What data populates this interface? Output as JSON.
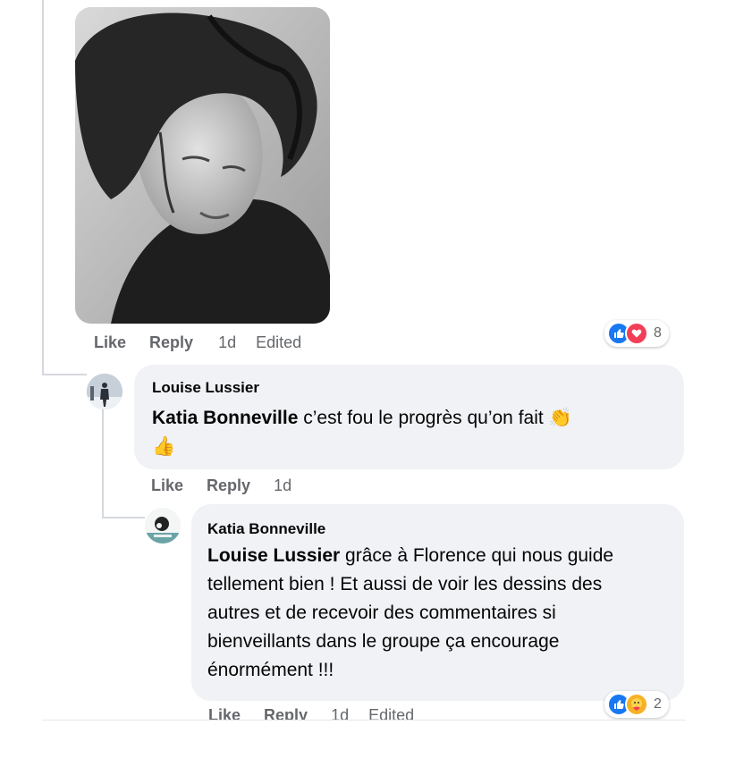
{
  "post": {
    "photo_icon": "pencil-portrait-drawing",
    "actions": {
      "like": "Like",
      "reply": "Reply",
      "time": "1d",
      "edited": "Edited"
    },
    "reactions": {
      "icons": [
        "like-icon",
        "love-icon"
      ],
      "count": "8"
    }
  },
  "comments": [
    {
      "author": "Louise Lussier",
      "mention": "Katia Bonneville",
      "text": " c’est fou le progrès qu’on fait ",
      "emoji": [
        "👏",
        "👍"
      ],
      "actions": {
        "like": "Like",
        "reply": "Reply",
        "time": "1d"
      }
    },
    {
      "author": "Katia Bonneville",
      "mention": "Louise Lussier",
      "text": " grâce à Florence qui nous guide tellement bien ! Et aussi de voir les dessins des autres et de recevoir des commentaires si bienveillants dans le groupe ça encourage énormément !!!",
      "actions": {
        "like": "Like",
        "reply": "Reply",
        "time": "1d",
        "edited": "Edited"
      },
      "reactions": {
        "icons": [
          "like-icon",
          "care-icon"
        ],
        "count": "2"
      }
    }
  ],
  "colors": {
    "like": "#1877f2",
    "love": "#f33e58",
    "care": "#f7b125",
    "bubble": "#f0f2f5",
    "muted": "#65676b"
  }
}
